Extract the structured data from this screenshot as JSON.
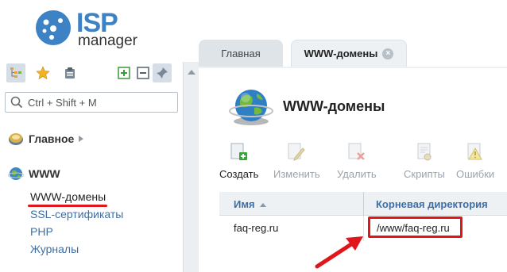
{
  "logo": {
    "brand": "ISP",
    "product": "manager"
  },
  "search": {
    "placeholder": "Ctrl + Shift + M"
  },
  "sidebar": {
    "groups": [
      {
        "label": "Главное"
      },
      {
        "label": "WWW",
        "items": [
          {
            "label": "WWW-домены"
          },
          {
            "label": "SSL-сертификаты"
          },
          {
            "label": "PHP"
          },
          {
            "label": "Журналы"
          }
        ]
      }
    ]
  },
  "tabs": [
    {
      "label": "Главная"
    },
    {
      "label": "WWW-домены"
    }
  ],
  "page": {
    "title": "WWW-домены"
  },
  "toolbar": {
    "create": "Создать",
    "edit": "Изменить",
    "delete": "Удалить",
    "scripts": "Скрипты",
    "errors": "Ошибки"
  },
  "table": {
    "columns": [
      "Имя",
      "Корневая директория"
    ],
    "rows": [
      {
        "name": "faq-reg.ru",
        "root": "/www/faq-reg.ru"
      }
    ]
  },
  "colors": {
    "accent": "#3d82c4",
    "highlight": "#e0161b",
    "link": "#3d6fa6"
  }
}
